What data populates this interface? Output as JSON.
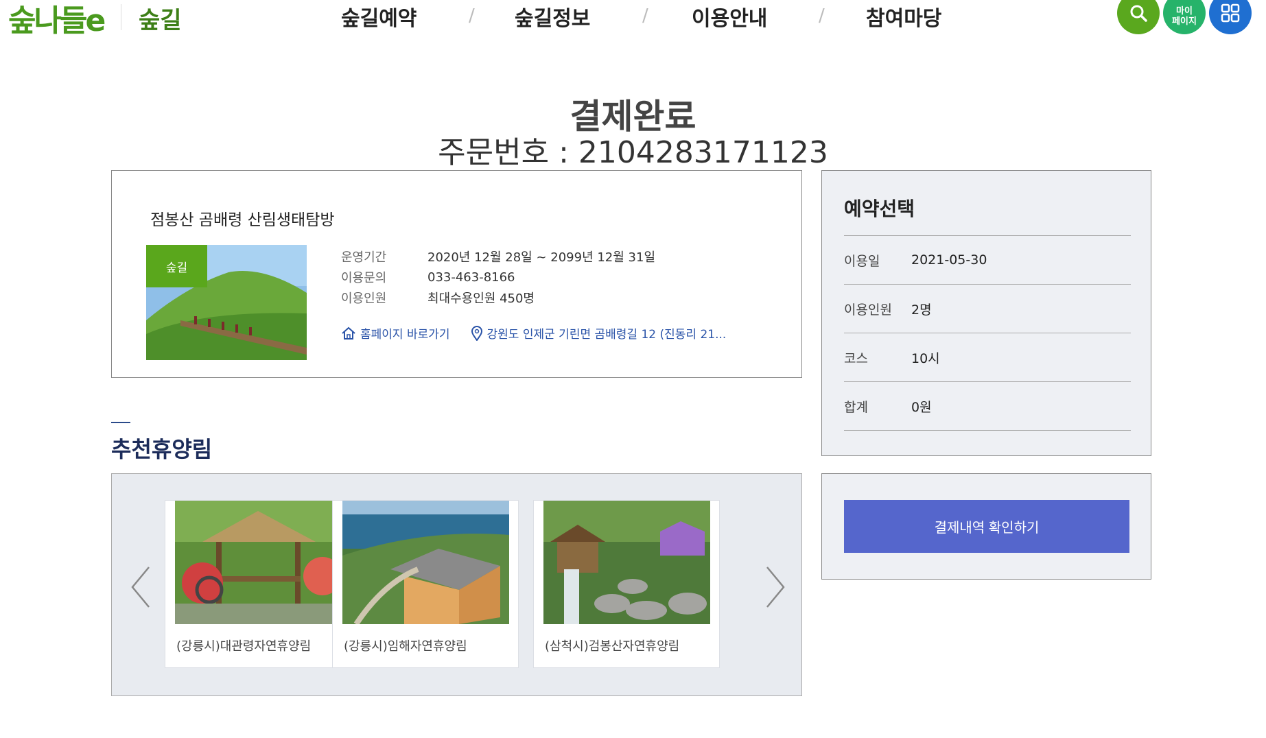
{
  "header": {
    "logo": "숲나들e",
    "section": "숲길",
    "nav": [
      "숲길예약",
      "숲길정보",
      "이용안내",
      "참여마당"
    ],
    "mypage": [
      "마이",
      "페이지"
    ]
  },
  "page": {
    "title": "결제완료",
    "order_label": "주문번호 : ",
    "order_no": "2104283171123"
  },
  "product": {
    "name": "점봉산 곰배령 산림생태탐방",
    "badge": "숲길",
    "info": [
      {
        "label": "운영기간",
        "value": "2020년 12월 28일 ~ 2099년 12월 31일"
      },
      {
        "label": "이용문의",
        "value": "033-463-8166"
      },
      {
        "label": "이용인원",
        "value": "최대수용인원 450명"
      }
    ],
    "homepage_link": "홈페이지 바로가기",
    "address": "강원도 인제군 기린면 곰배령길 12 (진동리 21..."
  },
  "reservation": {
    "title": "예약선택",
    "rows": [
      {
        "label": "이용일",
        "value": "2021-05-30"
      },
      {
        "label": "이용인원",
        "value": "2명"
      },
      {
        "label": "코스",
        "value": "10시"
      },
      {
        "label": "합계",
        "value": "0원"
      }
    ],
    "confirm_button": "결제내역 확인하기"
  },
  "recommend": {
    "title": "추천휴양림",
    "items": [
      {
        "name": "(강릉시)대관령자연휴양림"
      },
      {
        "name": "(강릉시)임해자연휴양림"
      },
      {
        "name": "(삼척시)검봉산자연휴양림"
      }
    ]
  },
  "colors": {
    "brand_green": "#4a9a1e",
    "confirm_button": "#5566cc",
    "title_navy": "#1c2c5a"
  }
}
